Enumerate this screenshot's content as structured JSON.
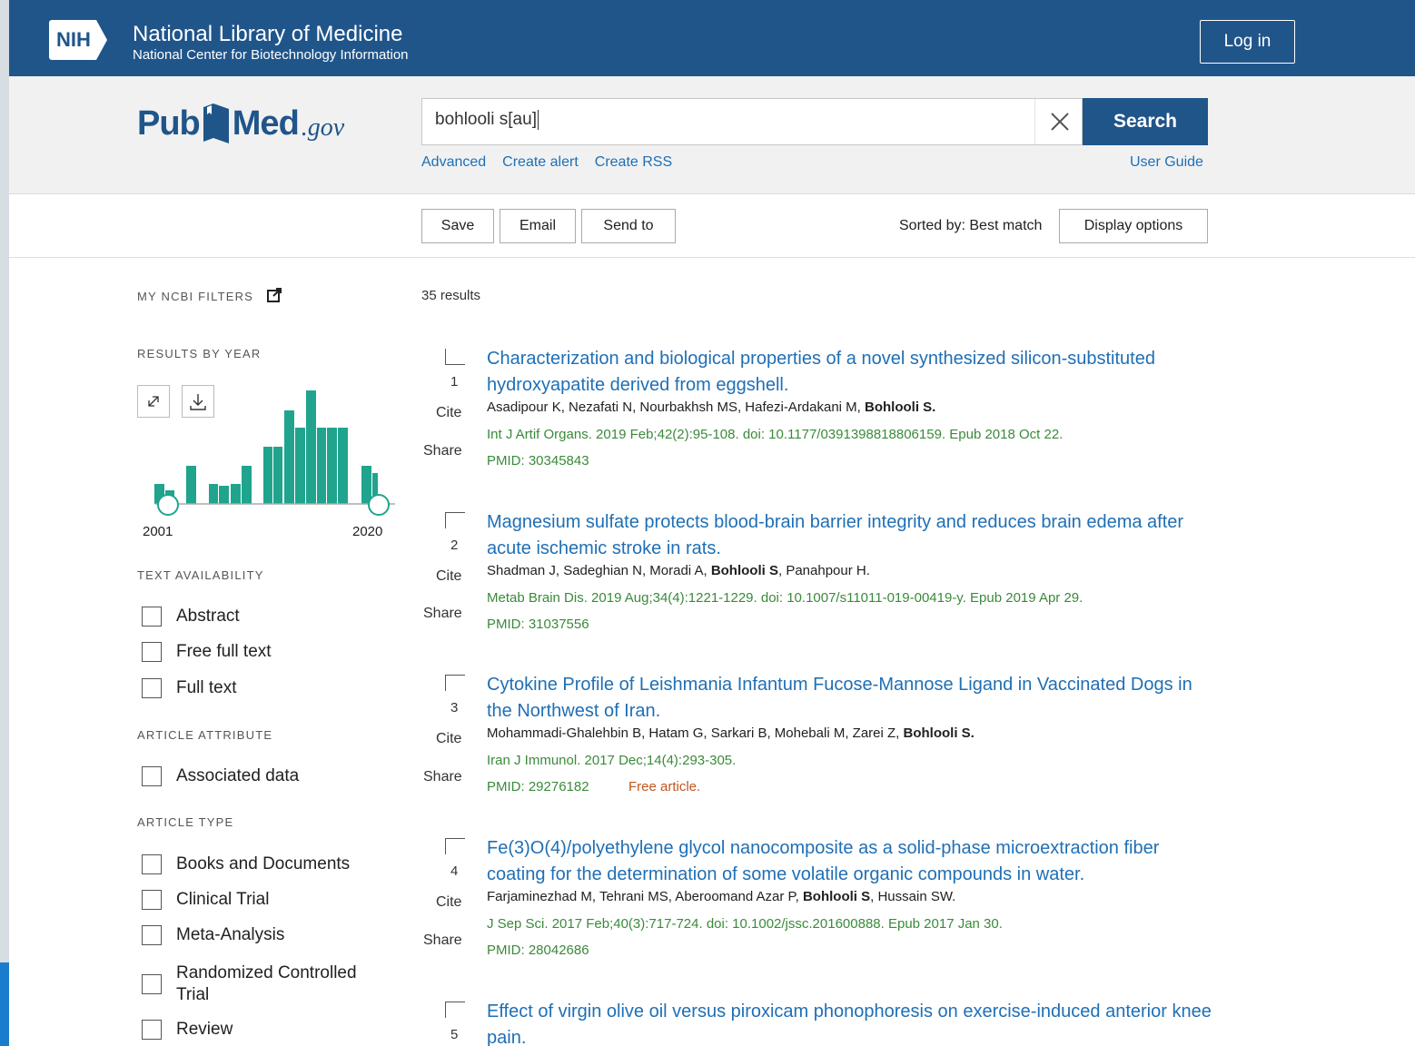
{
  "header": {
    "nih_logo": "NIH",
    "title": "National Library of Medicine",
    "subtitle": "National Center for Biotechnology Information",
    "login_label": "Log in"
  },
  "search": {
    "logo_pub": "Pub",
    "logo_med": "Med",
    "logo_gov": ".gov",
    "query": "bohlooli s[au]",
    "button_label": "Search",
    "links": [
      "Advanced",
      "Create alert",
      "Create RSS"
    ],
    "user_guide": "User Guide"
  },
  "actions": {
    "save": "Save",
    "email": "Email",
    "send_to": "Send to",
    "sorted_by": "Sorted by: Best match",
    "display_options": "Display options"
  },
  "sidebar": {
    "my_ncbi_filters": "MY NCBI FILTERS",
    "results_by_year": "RESULTS BY YEAR",
    "year_start": "2001",
    "year_end": "2020",
    "text_availability": "TEXT AVAILABILITY",
    "text_filters": [
      "Abstract",
      "Free full text",
      "Full text"
    ],
    "article_attribute": "ARTICLE ATTRIBUTE",
    "attribute_filters": [
      "Associated data"
    ],
    "article_type": "ARTICLE TYPE",
    "type_filters": [
      "Books and Documents",
      "Clinical Trial",
      "Meta-Analysis",
      "Randomized Controlled Trial",
      "Review"
    ],
    "histogram_color": "#20a48e"
  },
  "results": {
    "count": "35 results",
    "cite_label": "Cite",
    "share_label": "Share",
    "items": [
      {
        "num": "1",
        "title": "Characterization and biological properties of a novel synthesized silicon-substituted hydroxyapatite derived from eggshell.",
        "authors_pre": "Asadipour K, Nezafati N, Nourbakhsh MS, Hafezi-Ardakani M, ",
        "authors_bold": "Bohlooli S.",
        "authors_post": "",
        "journal": "Int J Artif Organs. 2019 Feb;42(2):95-108. doi: 10.1177/0391398818806159. Epub 2018 Oct 22.",
        "pmid": "PMID: 30345843",
        "free": ""
      },
      {
        "num": "2",
        "title": "Magnesium sulfate protects blood-brain barrier integrity and reduces brain edema after acute ischemic stroke in rats.",
        "authors_pre": "Shadman J, Sadeghian N, Moradi A, ",
        "authors_bold": "Bohlooli S",
        "authors_post": ", Panahpour H.",
        "journal": "Metab Brain Dis. 2019 Aug;34(4):1221-1229. doi: 10.1007/s11011-019-00419-y. Epub 2019 Apr 29.",
        "pmid": "PMID: 31037556",
        "free": ""
      },
      {
        "num": "3",
        "title": "Cytokine Profile of Leishmania Infantum Fucose-Mannose Ligand in Vaccinated Dogs in the Northwest of Iran.",
        "authors_pre": "Mohammadi-Ghalehbin B, Hatam G, Sarkari B, Mohebali M, Zarei Z, ",
        "authors_bold": "Bohlooli S.",
        "authors_post": "",
        "journal": "Iran J Immunol. 2017 Dec;14(4):293-305.",
        "pmid": "PMID: 29276182",
        "free": "Free article."
      },
      {
        "num": "4",
        "title": "Fe(3)O(4)/polyethylene glycol nanocomposite as a solid-phase microextraction fiber coating for the determination of some volatile organic compounds in water.",
        "authors_pre": "Farjaminezhad M, Tehrani MS, Aberoomand Azar P, ",
        "authors_bold": "Bohlooli S",
        "authors_post": ", Hussain SW.",
        "journal": "J Sep Sci. 2017 Feb;40(3):717-724. doi: 10.1002/jssc.201600888. Epub 2017 Jan 30.",
        "pmid": "PMID: 28042686",
        "free": ""
      },
      {
        "num": "5",
        "title": "Effect of virgin olive oil versus piroxicam phonophoresis on exercise-induced anterior knee pain.",
        "authors_pre": "",
        "authors_bold": "",
        "authors_post": "",
        "journal": "",
        "pmid": "",
        "free": ""
      }
    ]
  }
}
